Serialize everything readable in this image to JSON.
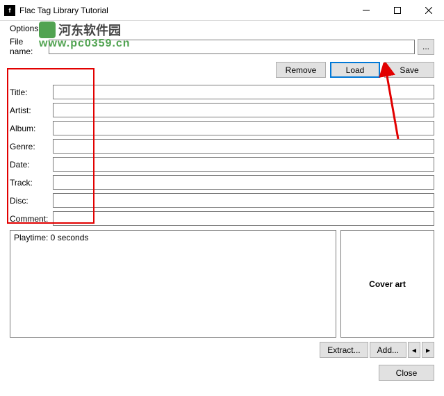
{
  "window": {
    "title": "Flac Tag Library Tutorial"
  },
  "menu": {
    "options": "Options"
  },
  "filename": {
    "label": "File name:",
    "value": "",
    "browse": "..."
  },
  "actions": {
    "remove": "Remove",
    "load": "Load",
    "save": "Save"
  },
  "fields": {
    "title": {
      "label": "Title:",
      "value": ""
    },
    "artist": {
      "label": "Artist:",
      "value": ""
    },
    "album": {
      "label": "Album:",
      "value": ""
    },
    "genre": {
      "label": "Genre:",
      "value": ""
    },
    "date": {
      "label": "Date:",
      "value": ""
    },
    "track": {
      "label": "Track:",
      "value": ""
    },
    "disc": {
      "label": "Disc:",
      "value": ""
    },
    "comment": {
      "label": "Comment:",
      "value": ""
    }
  },
  "playtime": {
    "text": "Playtime: 0 seconds"
  },
  "cover": {
    "label": "Cover art",
    "extract": "Extract...",
    "add": "Add...",
    "prev": "◂",
    "next": "▸"
  },
  "footer": {
    "close": "Close"
  },
  "watermark": {
    "cn": "河东软件园",
    "url": "www.pc0359.cn"
  }
}
